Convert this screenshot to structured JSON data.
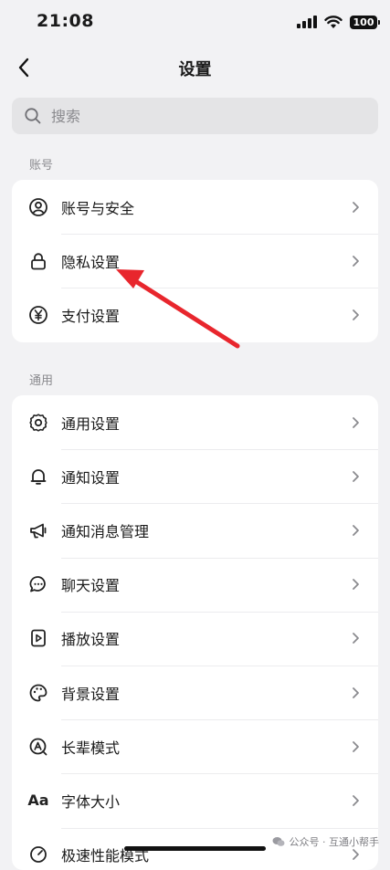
{
  "status_bar": {
    "time": "21:08",
    "battery": "100"
  },
  "nav": {
    "title": "设置"
  },
  "search": {
    "placeholder": "搜索"
  },
  "sections": {
    "account": {
      "label": "账号",
      "items": [
        {
          "label": "账号与安全",
          "icon": "user-circle-icon"
        },
        {
          "label": "隐私设置",
          "icon": "lock-icon"
        },
        {
          "label": "支付设置",
          "icon": "yuan-icon"
        }
      ]
    },
    "general": {
      "label": "通用",
      "items": [
        {
          "label": "通用设置",
          "icon": "gear-icon"
        },
        {
          "label": "通知设置",
          "icon": "bell-icon"
        },
        {
          "label": "通知消息管理",
          "icon": "megaphone-icon"
        },
        {
          "label": "聊天设置",
          "icon": "chat-bubble-icon"
        },
        {
          "label": "播放设置",
          "icon": "play-file-icon"
        },
        {
          "label": "背景设置",
          "icon": "palette-icon"
        },
        {
          "label": "长辈模式",
          "icon": "elder-mode-icon"
        },
        {
          "label": "字体大小",
          "icon": "font-size-icon",
          "glyph": "Aa"
        },
        {
          "label": "极速性能模式",
          "icon": "speed-icon"
        }
      ]
    }
  },
  "annotation": {
    "color": "#e8262d",
    "points_to": "隐私设置"
  },
  "watermark": {
    "text": "公众号 · 互通小帮手"
  }
}
